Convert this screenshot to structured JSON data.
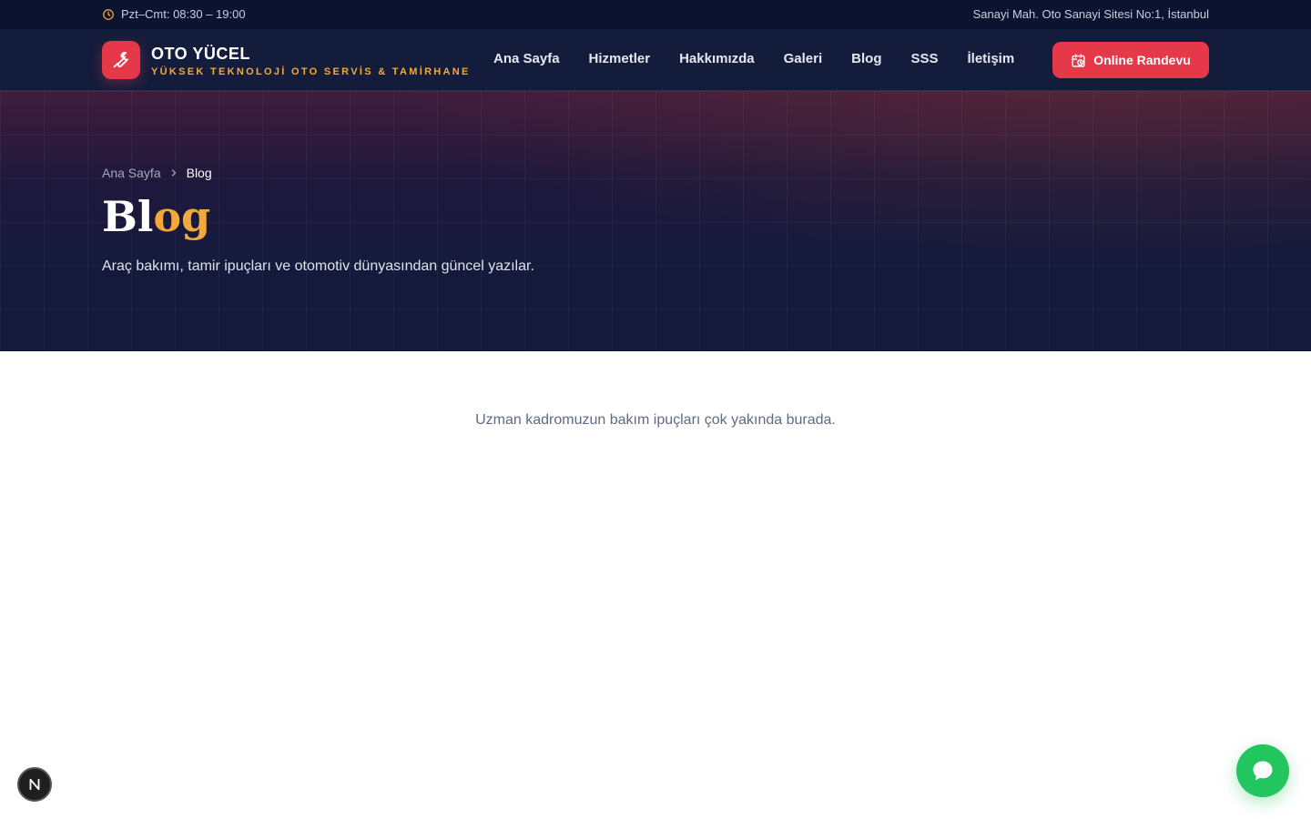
{
  "topbar": {
    "hours": "Pzt–Cmt: 08:30 – 19:00",
    "address": "Sanayi Mah. Oto Sanayi Sitesi No:1, İstanbul",
    "hours_icon": "clock-icon"
  },
  "brand": {
    "name": "OTO YÜCEL",
    "tagline": "YÜKSEK TEKNOLOJİ OTO SERVİS & TAMİRHANE",
    "logo_icon": "wrench-icon",
    "accent_color": "#e53848"
  },
  "nav": {
    "items": [
      {
        "label": "Ana Sayfa"
      },
      {
        "label": "Hizmetler"
      },
      {
        "label": "Hakkımızda"
      },
      {
        "label": "Galeri"
      },
      {
        "label": "Blog"
      },
      {
        "label": "SSS"
      },
      {
        "label": "İletişim"
      }
    ],
    "cta_label": "Online Randevu",
    "cta_icon": "calendar-icon"
  },
  "hero": {
    "breadcrumb": {
      "home": "Ana Sayfa",
      "current": "Blog"
    },
    "title_part1": "Bl",
    "title_part2": "og",
    "subtitle": "Araç bakımı, tamir ipuçları ve otomotiv dünyasından güncel yazılar.",
    "accent_color": "#f3a83b"
  },
  "content": {
    "empty_message": "Uzman kadromuzun bakım ipuçları çok yakında burada."
  },
  "floating": {
    "dev_badge_label": "N",
    "chat_icon": "chat-bubble-icon",
    "chat_color": "#22c55e"
  }
}
